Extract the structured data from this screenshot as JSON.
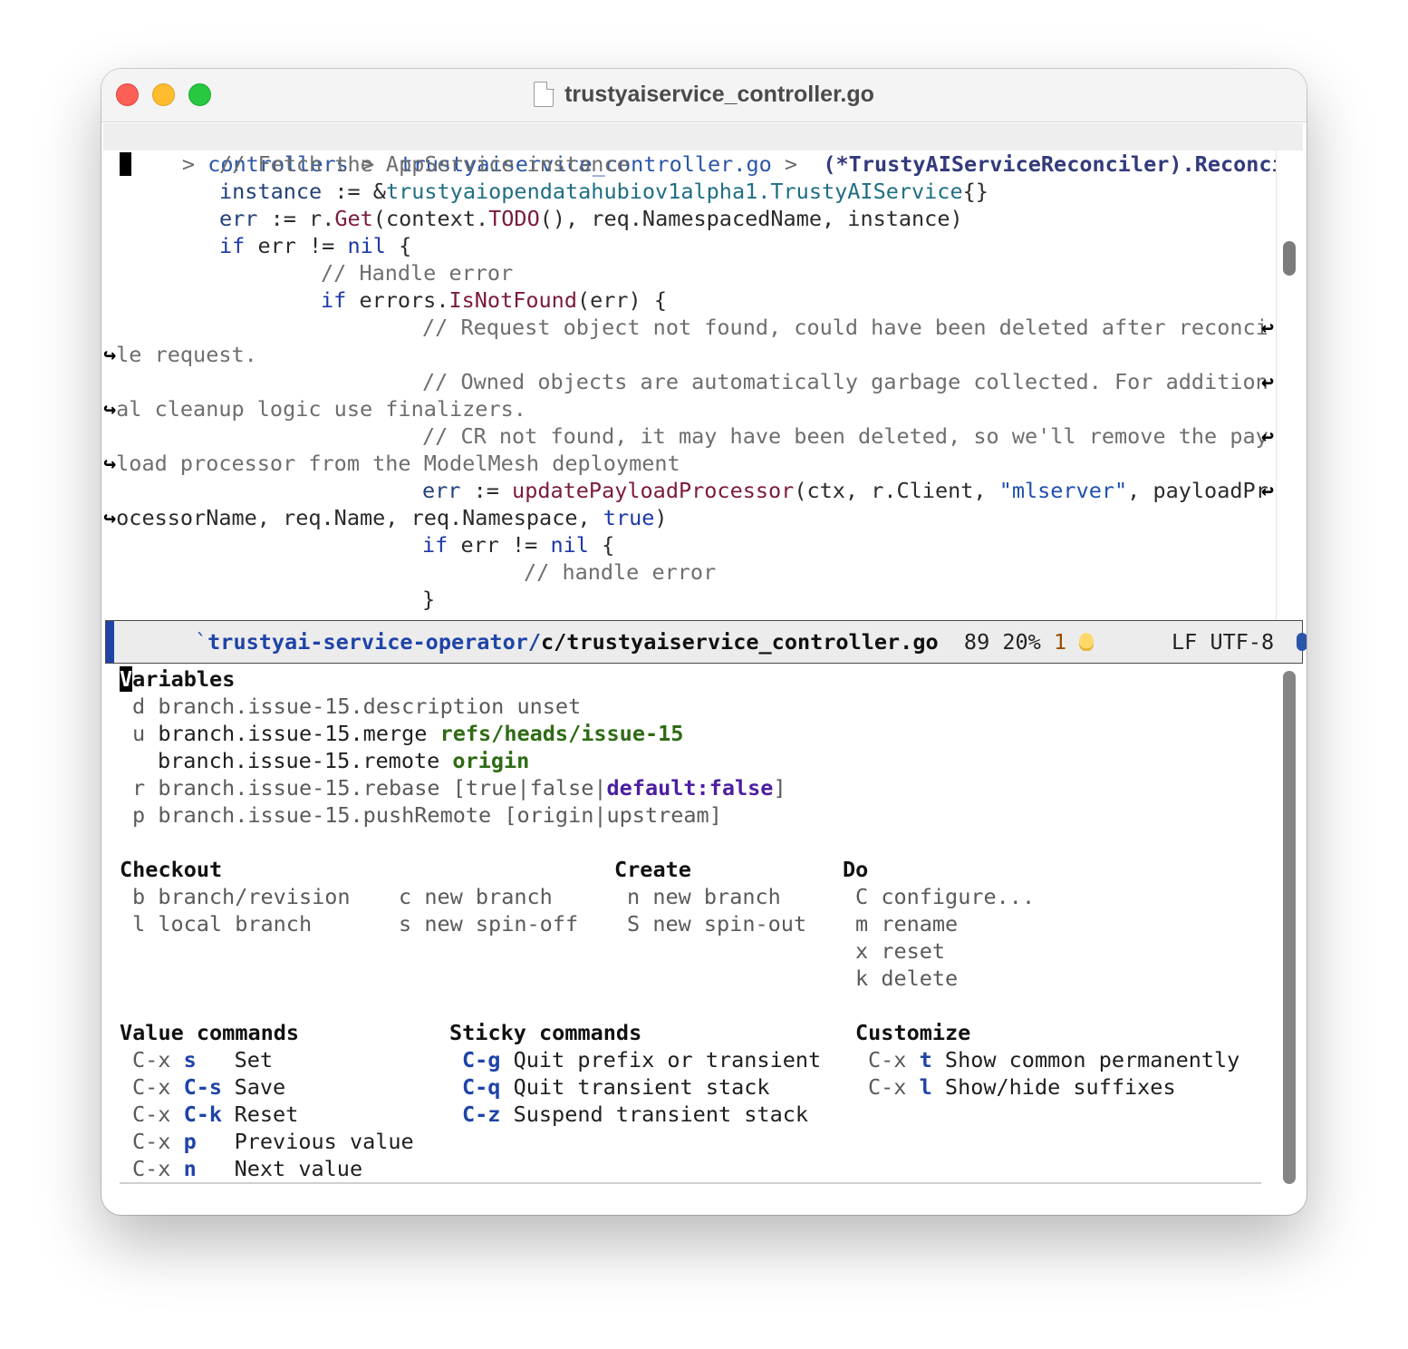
{
  "window": {
    "title": "trustyaiservice_controller.go"
  },
  "breadcrumb": {
    "lead": ">",
    "items": [
      "controllers",
      "trustyaiservice_controller.go",
      "(*TrustyAIServiceReconciler).Reconcile"
    ],
    "separator": ">"
  },
  "code": {
    "l1": "// Fetch the AppService instance",
    "l2a": "instance",
    "l2b": " := &",
    "l2c": "trustyaiopendatahubiov1alpha1.TrustyAIService",
    "l2d": "{}",
    "l3a": "err",
    "l3b": " := r.",
    "l3c": "Get",
    "l3d": "(context.",
    "l3e": "TODO",
    "l3f": "(), req.NamespacedName, instance)",
    "l4a": "if",
    "l4b": " err != ",
    "l4c": "nil",
    "l4d": " {",
    "l5": "// Handle error",
    "l6a": "if",
    "l6b": " errors.",
    "l6c": "IsNotFound",
    "l6d": "(err) {",
    "l7": "// Request object not found, could have been deleted after reconci",
    "l8": "le request.",
    "l9": "// Owned objects are automatically garbage collected. For addition",
    "l10": "al cleanup logic use finalizers.",
    "l11": "// CR not found, it may have been deleted, so we'll remove the pay",
    "l12": "load processor from the ModelMesh deployment",
    "l13a": "err",
    "l13b": " := ",
    "l13c": "updatePayloadProcessor",
    "l13d": "(ctx, r.Client, ",
    "l13e": "\"mlserver\"",
    "l13f": ", payloadPr",
    "l14a": "ocessorName, req.Name, req.Namespace, ",
    "l14b": "true",
    "l14c": ")",
    "l15a": "if",
    "l15b": " err != ",
    "l15c": "nil",
    "l15d": " {",
    "l16": "// handle error",
    "l17": "}",
    "wrap_right": "↩",
    "wrap_left": "↪"
  },
  "modeline": {
    "tick": "`",
    "path": "trustyai-service-operator/",
    "file": "c/trustyaiservice_controller.go",
    "line": "89",
    "percent": "20%",
    "column": "1",
    "eol": "LF",
    "encoding": "UTF-8"
  },
  "transient": {
    "variables": {
      "title_first": "V",
      "title_rest": "ariables",
      "rows": [
        {
          "key": "d",
          "name": "branch.issue-15.description",
          "value": "unset"
        },
        {
          "key": "u",
          "name": "branch.issue-15.merge",
          "value": "refs/heads/issue-15"
        },
        {
          "key": "",
          "name": "branch.issue-15.remote",
          "value": "origin"
        },
        {
          "key": "r",
          "name": "branch.issue-15.rebase",
          "value_pre": "[true|false|",
          "value_sel": "default:false",
          "value_post": "]"
        },
        {
          "key": "p",
          "name": "branch.issue-15.pushRemote",
          "value": "[origin|upstream]"
        }
      ]
    },
    "checkout": {
      "title": "Checkout",
      "col1": [
        {
          "key": "b",
          "label": "branch/revision"
        },
        {
          "key": "l",
          "label": "local branch"
        }
      ],
      "col2": [
        {
          "key": "c",
          "label": "new branch"
        },
        {
          "key": "s",
          "label": "new spin-off"
        }
      ]
    },
    "create": {
      "title": "Create",
      "items": [
        {
          "key": "n",
          "label": "new branch"
        },
        {
          "key": "S",
          "label": "new spin-out"
        }
      ]
    },
    "do": {
      "title": "Do",
      "items": [
        {
          "key": "C",
          "label": "configure..."
        },
        {
          "key": "m",
          "label": "rename"
        },
        {
          "key": "x",
          "label": "reset"
        },
        {
          "key": "k",
          "label": "delete"
        }
      ]
    },
    "value_commands": {
      "title": "Value commands",
      "prefix": "C-x",
      "items": [
        {
          "key": "s",
          "label": "Set"
        },
        {
          "key": "C-s",
          "label": "Save"
        },
        {
          "key": "C-k",
          "label": "Reset"
        },
        {
          "key": "p",
          "label": "Previous value"
        },
        {
          "key": "n",
          "label": "Next value"
        }
      ]
    },
    "sticky_commands": {
      "title": "Sticky commands",
      "items": [
        {
          "key": "C-g",
          "label": "Quit prefix or transient"
        },
        {
          "key": "C-q",
          "label": "Quit transient stack"
        },
        {
          "key": "C-z",
          "label": "Suspend transient stack"
        }
      ]
    },
    "customize": {
      "title": "Customize",
      "prefix": "C-x",
      "items": [
        {
          "key": "t",
          "label": "Show common permanently"
        },
        {
          "key": "l",
          "label": "Show/hide suffixes"
        }
      ]
    }
  },
  "colors": {
    "keyword": "#1d38a8",
    "function": "#7a1a3c",
    "comment": "#6e6e6e",
    "green_value": "#2e6b14",
    "purple_value": "#4b1fa0",
    "modeline_accent": "#1f44a8"
  }
}
